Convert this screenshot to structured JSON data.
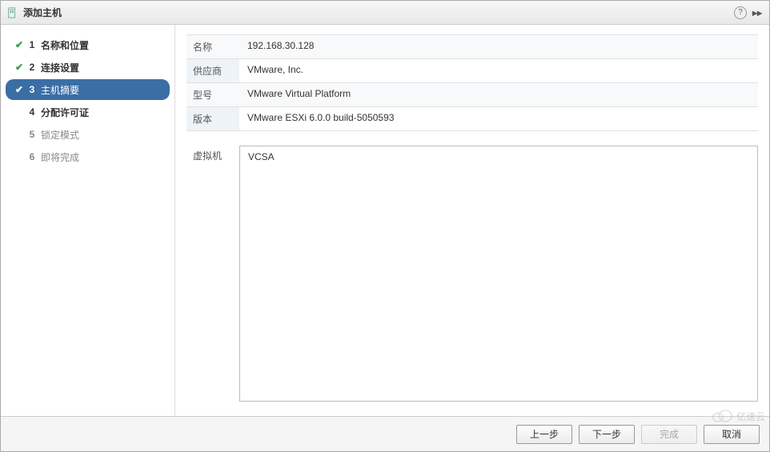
{
  "titlebar": {
    "title": "添加主机"
  },
  "steps": [
    {
      "num": "1",
      "label": "名称和位置",
      "state": "completed"
    },
    {
      "num": "2",
      "label": "连接设置",
      "state": "completed"
    },
    {
      "num": "3",
      "label": "主机摘要",
      "state": "active"
    },
    {
      "num": "4",
      "label": "分配许可证",
      "state": "next"
    },
    {
      "num": "5",
      "label": "锁定模式",
      "state": "future"
    },
    {
      "num": "6",
      "label": "即将完成",
      "state": "future"
    }
  ],
  "summary": {
    "name_label": "名称",
    "name_value": "192.168.30.128",
    "vendor_label": "供应商",
    "vendor_value": "VMware, Inc.",
    "model_label": "型号",
    "model_value": "VMware Virtual Platform",
    "version_label": "版本",
    "version_value": "VMware ESXi 6.0.0 build-5050593"
  },
  "vms": {
    "label": "虚拟机",
    "items": [
      "VCSA"
    ]
  },
  "footer": {
    "back": "上一步",
    "next": "下一步",
    "finish": "完成",
    "cancel": "取消"
  },
  "watermark": "亿速云"
}
